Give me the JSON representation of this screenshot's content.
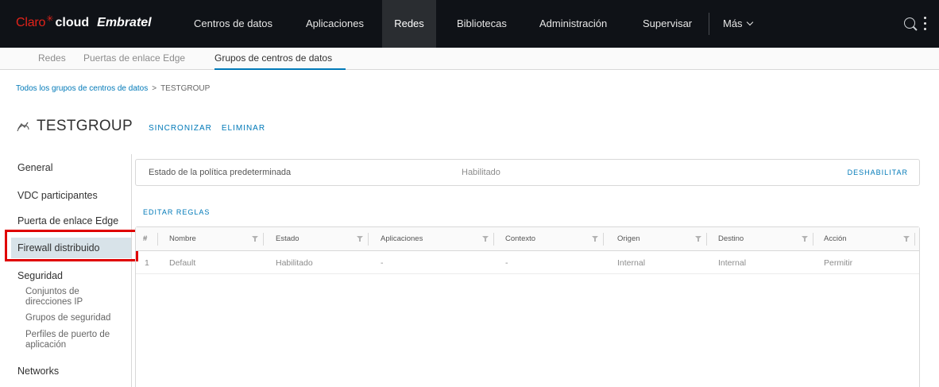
{
  "brand": {
    "claro": "Claro",
    "cloud": "cloud",
    "embratel": "Embratel"
  },
  "topnav": {
    "items": [
      "Centros de datos",
      "Aplicaciones",
      "Redes",
      "Bibliotecas",
      "Administración",
      "Supervisar"
    ],
    "more": "Más",
    "active": "Redes"
  },
  "subnav": {
    "items": [
      "Redes",
      "Puertas de enlace Edge",
      "Grupos de centros de datos"
    ],
    "active": "Grupos de centros de datos"
  },
  "breadcrumb": {
    "link": "Todos los grupos de centros de datos",
    "separator": ">",
    "current": "TESTGROUP"
  },
  "page": {
    "title": "TESTGROUP",
    "actions": [
      "SINCRONIZAR",
      "ELIMINAR"
    ]
  },
  "sidebar": {
    "items": [
      "General",
      "VDC participantes",
      "Puerta de enlace Edge",
      "Firewall distribuido",
      "Seguridad",
      "Networks"
    ],
    "security_sub": [
      "Conjuntos de direcciones IP",
      "Grupos de seguridad",
      "Perfiles de puerto de aplicación"
    ],
    "active": "Firewall distribuido"
  },
  "policy": {
    "label": "Estado de la política predeterminada",
    "value": "Habilitado",
    "action": "DESHABILITAR"
  },
  "rules": {
    "edit_label": "EDITAR REGLAS",
    "columns": [
      "#",
      "Nombre",
      "Estado",
      "Aplicaciones",
      "Contexto",
      "Origen",
      "Destino",
      "Acción"
    ],
    "rows": [
      {
        "num": "1",
        "name": "Default",
        "state": "Habilitado",
        "apps": "-",
        "context": "-",
        "source": "Internal",
        "dest": "Internal",
        "action": "Permitir"
      }
    ]
  },
  "colors": {
    "accent": "#0079b8",
    "nav_bg": "#0f1217",
    "highlight": "#e00000",
    "brand_red": "#e2231a"
  }
}
